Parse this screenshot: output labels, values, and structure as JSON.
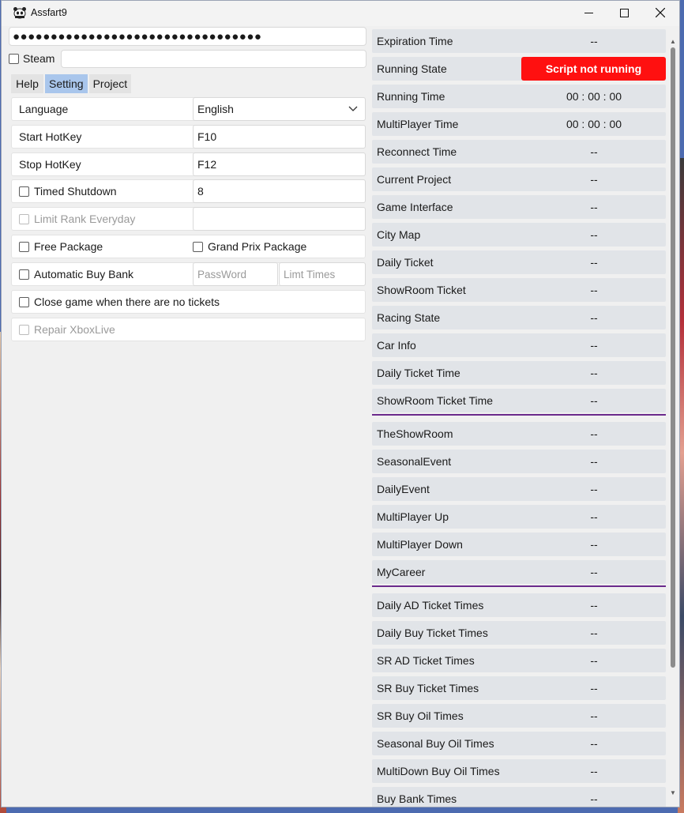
{
  "window": {
    "title": "Assfart9"
  },
  "account": {
    "password_mask": "●●●●●●●●●●●●●●●●●●●●●●●●●●●●●●●●●",
    "steam_label": "Steam",
    "steam_value": ""
  },
  "tabs": [
    {
      "label": "Help",
      "active": false
    },
    {
      "label": "Setting",
      "active": true
    },
    {
      "label": "Project",
      "active": false
    }
  ],
  "settings": {
    "language_label": "Language",
    "language_value": "English",
    "start_hotkey_label": "Start HotKey",
    "start_hotkey_value": "F10",
    "stop_hotkey_label": "Stop HotKey",
    "stop_hotkey_value": "F12",
    "timed_shutdown_label": "Timed Shutdown",
    "timed_shutdown_value": "8",
    "limit_rank_label": "Limit Rank Everyday",
    "limit_rank_value": "",
    "free_package_label": "Free Package",
    "grand_prix_label": "Grand Prix Package",
    "auto_buy_bank_label": "Automatic Buy Bank",
    "password_placeholder": "PassWord",
    "limit_times_placeholder": "Limt Times",
    "close_game_label": "Close game when there are no tickets",
    "repair_xbox_label": "Repair XboxLive"
  },
  "status_groups": [
    [
      {
        "key": "Expiration Time",
        "value": "--"
      },
      {
        "key": "Running State",
        "value": "Script not running",
        "alert": true
      },
      {
        "key": "Running Time",
        "value": "00 : 00 : 00"
      },
      {
        "key": "MultiPlayer Time",
        "value": "00 : 00 : 00"
      },
      {
        "key": "Reconnect Time",
        "value": "--"
      },
      {
        "key": "Current Project",
        "value": "--"
      },
      {
        "key": "Game Interface",
        "value": "--"
      },
      {
        "key": "City Map",
        "value": "--"
      },
      {
        "key": "Daily Ticket",
        "value": "--"
      },
      {
        "key": "ShowRoom Ticket",
        "value": "--"
      },
      {
        "key": "Racing State",
        "value": "--"
      },
      {
        "key": "Car Info",
        "value": "--"
      },
      {
        "key": "Daily Ticket Time",
        "value": "--"
      },
      {
        "key": "ShowRoom Ticket Time",
        "value": "--"
      }
    ],
    [
      {
        "key": "TheShowRoom",
        "value": "--"
      },
      {
        "key": "SeasonalEvent",
        "value": "--"
      },
      {
        "key": "DailyEvent",
        "value": "--"
      },
      {
        "key": "MultiPlayer Up",
        "value": "--"
      },
      {
        "key": "MultiPlayer Down",
        "value": "--"
      },
      {
        "key": "MyCareer",
        "value": "--"
      }
    ],
    [
      {
        "key": "Daily AD Ticket Times",
        "value": "--"
      },
      {
        "key": "Daily Buy Ticket Times",
        "value": "--"
      },
      {
        "key": "SR AD Ticket Times",
        "value": "--"
      },
      {
        "key": "SR Buy Ticket Times",
        "value": "--"
      },
      {
        "key": "SR Buy Oil Times",
        "value": "--"
      },
      {
        "key": "Seasonal Buy Oil Times",
        "value": "--"
      },
      {
        "key": "MultiDown Buy Oil Times",
        "value": "--"
      },
      {
        "key": "Buy Bank Times",
        "value": "--"
      }
    ]
  ],
  "colors": {
    "alert_red": "#ff1010",
    "separator_purple": "#6b2a8c",
    "active_tab": "#a9c6ec"
  }
}
